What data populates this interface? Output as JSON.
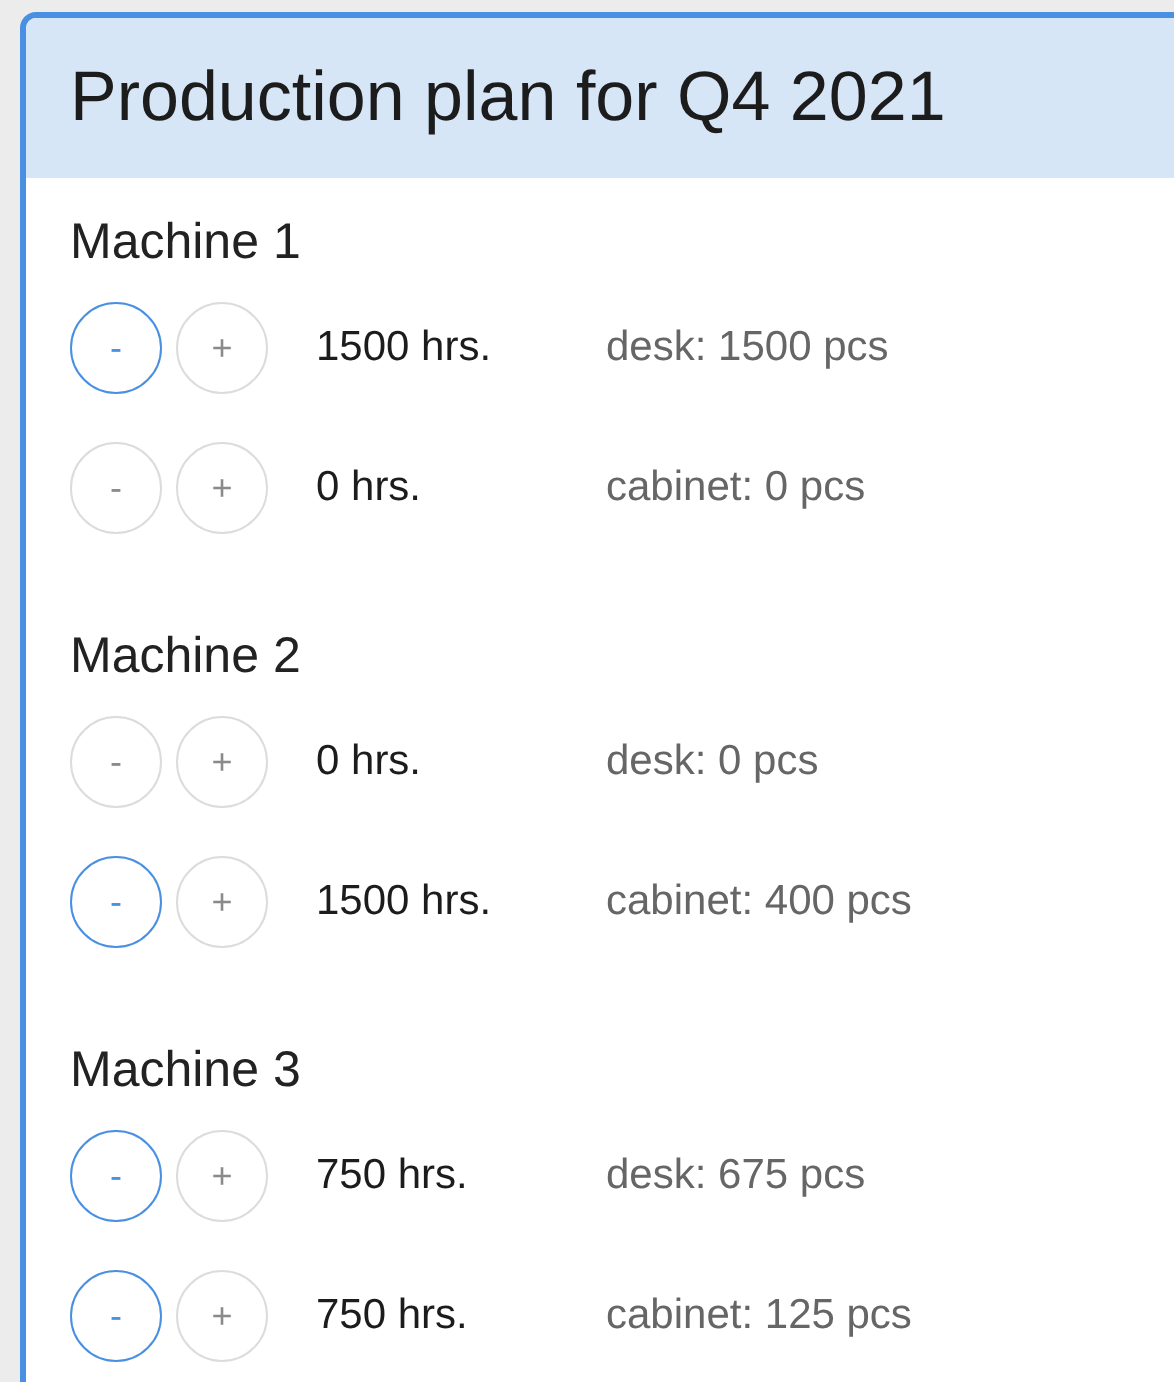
{
  "title": "Production plan for Q4 2021",
  "machines": [
    {
      "name": "Machine 1",
      "rows": [
        {
          "minus": {
            "label": "-",
            "disabled": false
          },
          "plus": {
            "label": "+",
            "disabled": true
          },
          "hours": "1500 hrs.",
          "output": "desk: 1500 pcs"
        },
        {
          "minus": {
            "label": "-",
            "disabled": true
          },
          "plus": {
            "label": "+",
            "disabled": true
          },
          "hours": "0 hrs.",
          "output": "cabinet: 0 pcs"
        }
      ]
    },
    {
      "name": "Machine 2",
      "rows": [
        {
          "minus": {
            "label": "-",
            "disabled": true
          },
          "plus": {
            "label": "+",
            "disabled": true
          },
          "hours": "0 hrs.",
          "output": "desk: 0 pcs"
        },
        {
          "minus": {
            "label": "-",
            "disabled": false
          },
          "plus": {
            "label": "+",
            "disabled": true
          },
          "hours": "1500 hrs.",
          "output": "cabinet: 400 pcs"
        }
      ]
    },
    {
      "name": "Machine 3",
      "rows": [
        {
          "minus": {
            "label": "-",
            "disabled": false
          },
          "plus": {
            "label": "+",
            "disabled": true
          },
          "hours": "750 hrs.",
          "output": "desk: 675 pcs"
        },
        {
          "minus": {
            "label": "-",
            "disabled": false
          },
          "plus": {
            "label": "+",
            "disabled": true
          },
          "hours": "750 hrs.",
          "output": "cabinet: 125 pcs"
        }
      ]
    }
  ]
}
